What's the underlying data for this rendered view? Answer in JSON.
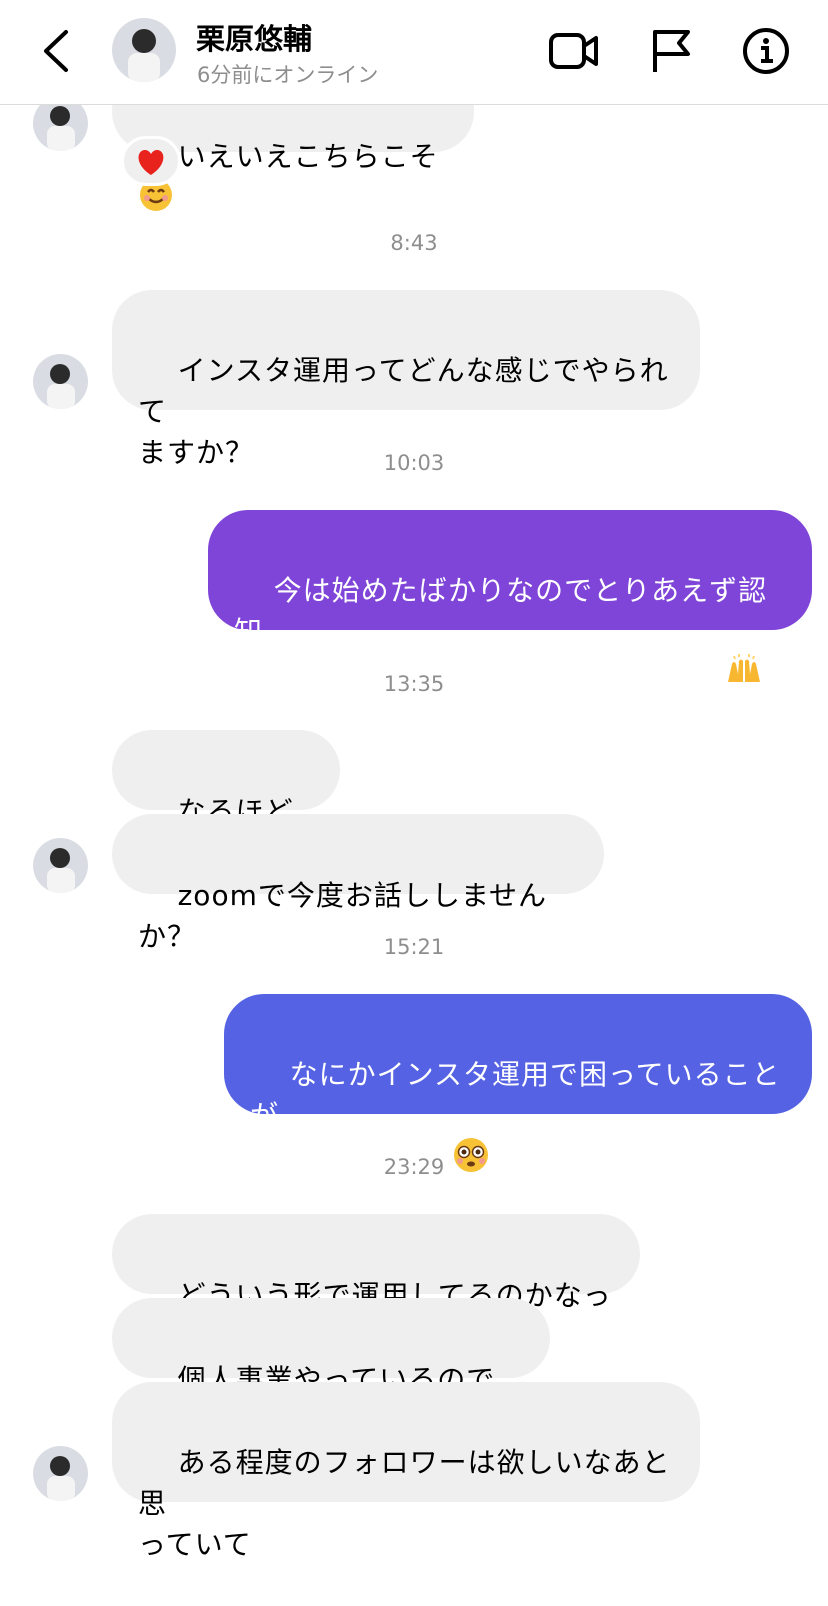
{
  "header": {
    "contact_name": "栗原悠輔",
    "status": "6分前にオンライン",
    "icons": [
      "back-chevron-icon",
      "video-call-icon",
      "report-flag-icon",
      "info-icon"
    ]
  },
  "colors": {
    "incoming_bubble": "#efefef",
    "outgoing_purple": "#7f45d8",
    "outgoing_blue": "#5462e3",
    "timestamp": "#8e8e8e"
  },
  "messages": {
    "m0": "いえいえこちらこそ",
    "m0_reaction": "heart-reaction",
    "t1": "8:43",
    "m1": "インスタ運用ってどんな感じでやられて\nますか？",
    "t2": "10:03",
    "m2": "今は始めたばかりなのでとりあえず認知\n度を上げるように心がけてやってます",
    "t3": "13:35",
    "m3": "なるほどお！",
    "m4": "zoomで今度お話ししませんか？",
    "t4": "15:21",
    "m5": "なにかインスタ運用で困っていることが\nあるんですか？",
    "t5": "23:29",
    "m6": "どういう形で運用してるのかなって",
    "m7": "個人事業やっているのですが",
    "m8": "ある程度のフォロワーは欲しいなあと思\nっていて"
  }
}
